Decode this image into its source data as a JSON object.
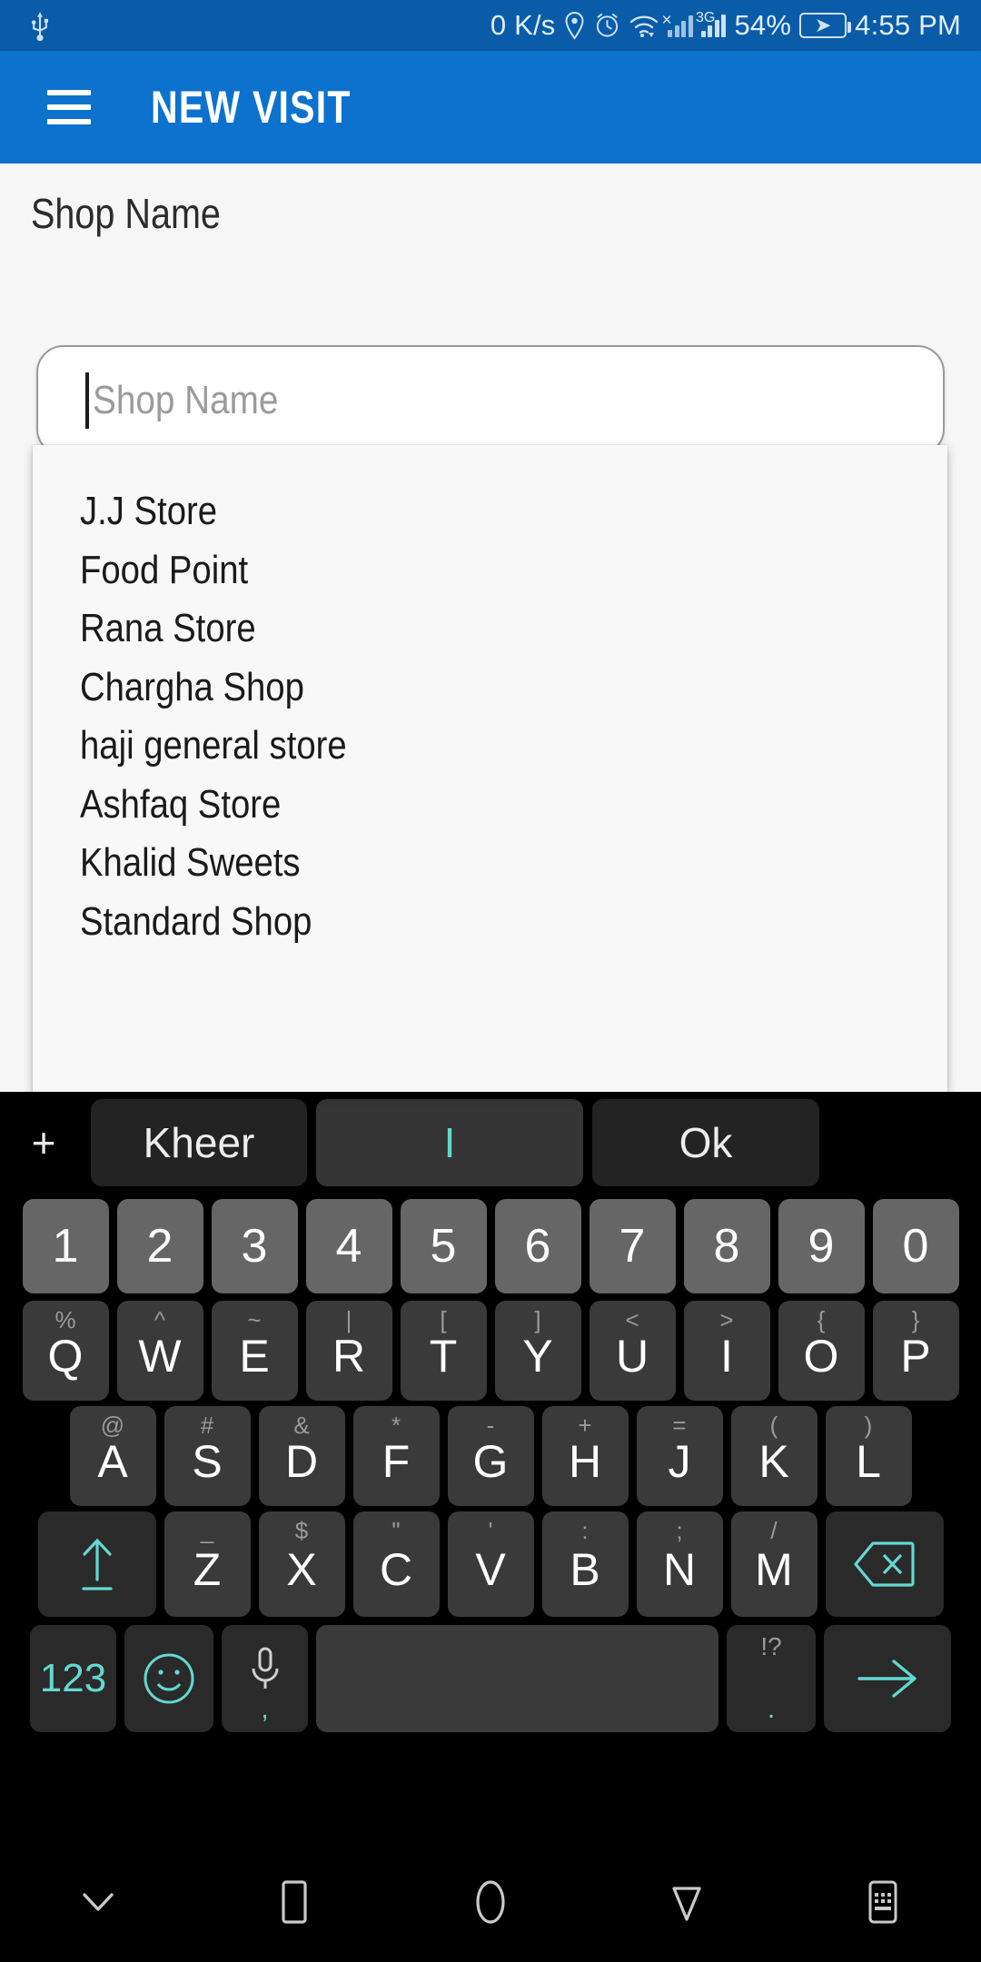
{
  "statusbar": {
    "usb_icon": "usb-icon",
    "network_speed": "0 K/s",
    "location_icon": "location-icon",
    "alarm_icon": "alarm-icon",
    "wifi_icon": "wifi-icon",
    "signal_icon": "signal-bars-icon",
    "signal_no_service_icon": "no-service-x-icon",
    "network_type": "3G",
    "battery_percent": "54%",
    "battery_icon": "battery-charging-icon",
    "time": "4:55 PM"
  },
  "appbar": {
    "menu_icon": "hamburger-menu-icon",
    "title": "NEW VISIT",
    "background": "#0c72ce"
  },
  "form": {
    "shop_label": "Shop Name",
    "shop_input_value": "",
    "shop_input_placeholder": "Shop Name"
  },
  "dropdown": {
    "items": [
      {
        "label": "J.J Store"
      },
      {
        "label": "Food Point"
      },
      {
        "label": "Rana Store"
      },
      {
        "label": "Chargha Shop"
      },
      {
        "label": "haji general store"
      },
      {
        "label": "Ashfaq Store"
      },
      {
        "label": "Khalid Sweets"
      },
      {
        "label": "Standard Shop"
      }
    ]
  },
  "keyboard": {
    "accent_color": "#63d8d1",
    "suggestions": {
      "add_icon": "plus-icon",
      "left": "Kheer",
      "center": "I",
      "right": "Ok"
    },
    "row_numbers": [
      {
        "main": "1"
      },
      {
        "main": "2"
      },
      {
        "main": "3"
      },
      {
        "main": "4"
      },
      {
        "main": "5"
      },
      {
        "main": "6"
      },
      {
        "main": "7"
      },
      {
        "main": "8"
      },
      {
        "main": "9"
      },
      {
        "main": "0"
      }
    ],
    "row_q": [
      {
        "main": "Q",
        "sub": "%"
      },
      {
        "main": "W",
        "sub": "^"
      },
      {
        "main": "E",
        "sub": "~"
      },
      {
        "main": "R",
        "sub": "|"
      },
      {
        "main": "T",
        "sub": "["
      },
      {
        "main": "Y",
        "sub": "]"
      },
      {
        "main": "U",
        "sub": "<"
      },
      {
        "main": "I",
        "sub": ">"
      },
      {
        "main": "O",
        "sub": "{"
      },
      {
        "main": "P",
        "sub": "}"
      }
    ],
    "row_a": [
      {
        "main": "A",
        "sub": "@"
      },
      {
        "main": "S",
        "sub": "#"
      },
      {
        "main": "D",
        "sub": "&"
      },
      {
        "main": "F",
        "sub": "*"
      },
      {
        "main": "G",
        "sub": "-"
      },
      {
        "main": "H",
        "sub": "+"
      },
      {
        "main": "J",
        "sub": "="
      },
      {
        "main": "K",
        "sub": "("
      },
      {
        "main": "L",
        "sub": ")"
      }
    ],
    "row_z": [
      {
        "main": "Z",
        "sub": "_"
      },
      {
        "main": "X",
        "sub": "$"
      },
      {
        "main": "C",
        "sub": "\""
      },
      {
        "main": "V",
        "sub": "'"
      },
      {
        "main": "B",
        "sub": ":"
      },
      {
        "main": "N",
        "sub": ";"
      },
      {
        "main": "M",
        "sub": "/"
      }
    ],
    "shift_icon": "shift-arrow-up-icon",
    "backspace_icon": "backspace-delete-icon",
    "row_bottom": {
      "numeric_label": "123",
      "emoji_icon": "emoji-smiley-icon",
      "mic_icon": "microphone-icon",
      "mic_sub": ",",
      "space_label": "",
      "period_sub": "!?",
      "period_main": ".",
      "enter_icon": "enter-arrow-right-icon"
    }
  },
  "navbar": {
    "items": [
      {
        "icon": "hide-keyboard-chevron-down-icon"
      },
      {
        "icon": "recents-square-icon"
      },
      {
        "icon": "home-circle-icon"
      },
      {
        "icon": "back-triangle-icon"
      },
      {
        "icon": "switch-keyboard-icon"
      }
    ]
  }
}
